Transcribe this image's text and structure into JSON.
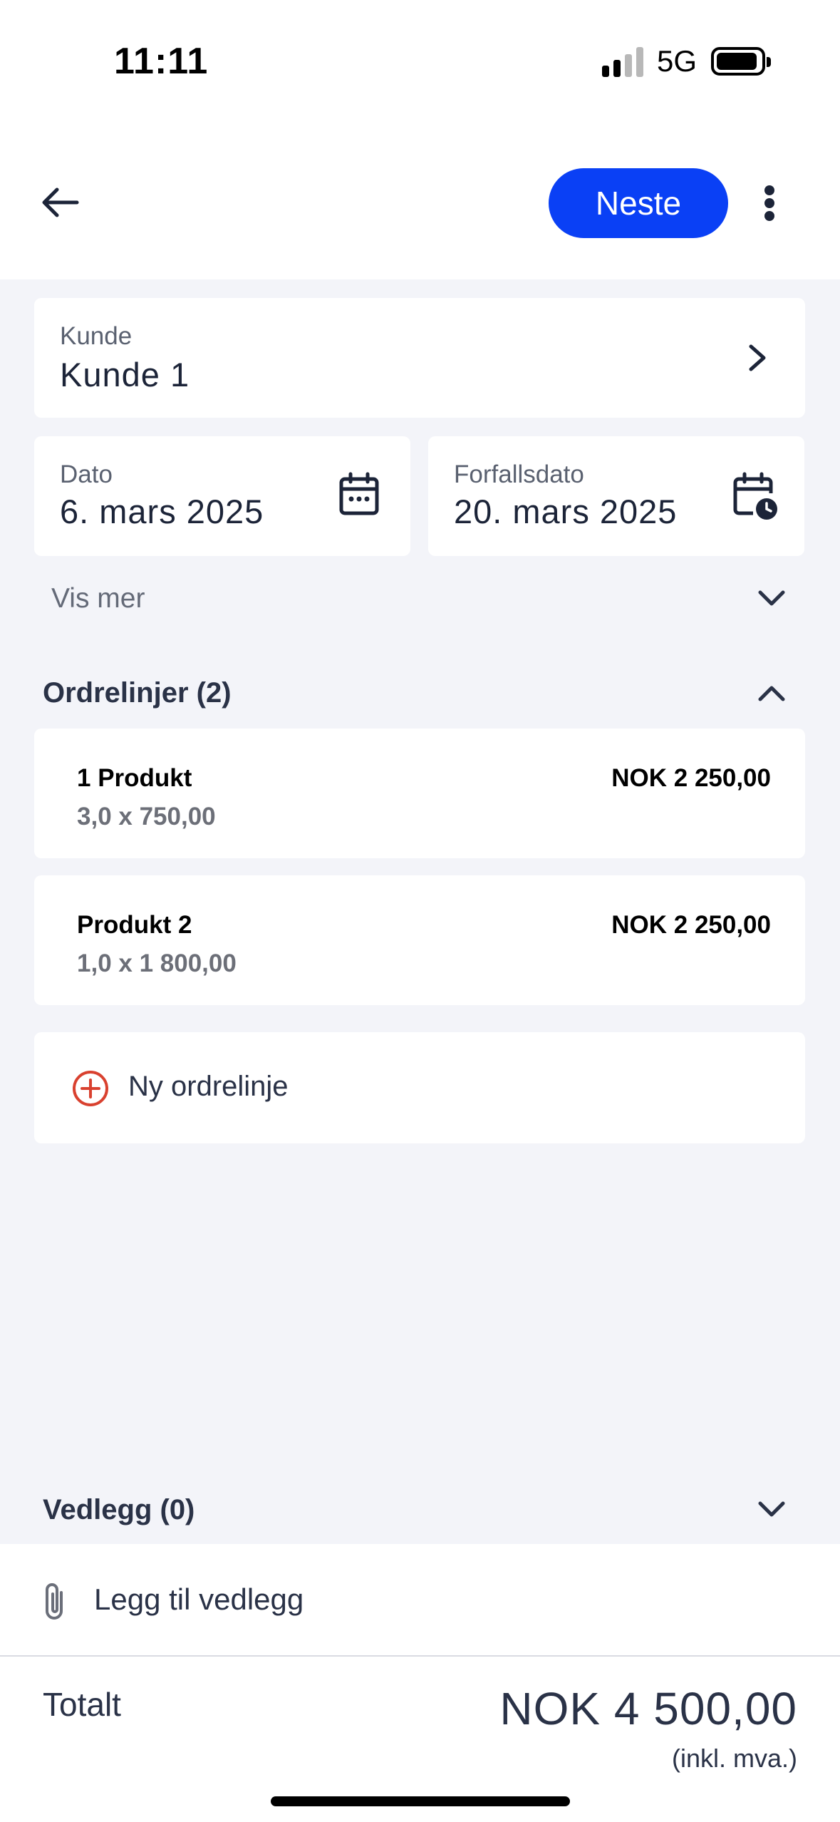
{
  "status_bar": {
    "time": "11:11",
    "network": "5G"
  },
  "header": {
    "next_label": "Neste"
  },
  "customer": {
    "label": "Kunde",
    "value": "Kunde 1"
  },
  "date": {
    "label": "Dato",
    "value": "6. mars 2025"
  },
  "due_date": {
    "label": "Forfallsdato",
    "value": "20. mars 2025"
  },
  "show_more": "Vis mer",
  "order_lines": {
    "title": "Ordrelinjer (2)",
    "items": [
      {
        "name": "1 Produkt",
        "qty_price": "3,0 x 750,00",
        "amount": "NOK 2 250,00"
      },
      {
        "name": "Produkt 2",
        "qty_price": "1,0 x 1 800,00",
        "amount": "NOK 2 250,00"
      }
    ],
    "add_label": "Ny ordrelinje"
  },
  "attachments": {
    "title": "Vedlegg (0)",
    "add_label": "Legg til vedlegg"
  },
  "total": {
    "label": "Totalt",
    "amount": "NOK 4 500,00",
    "note": "(inkl. mva.)"
  },
  "colors": {
    "accent": "#0a40f5",
    "add_icon": "#d9412f",
    "background": "#f3f4f9"
  }
}
